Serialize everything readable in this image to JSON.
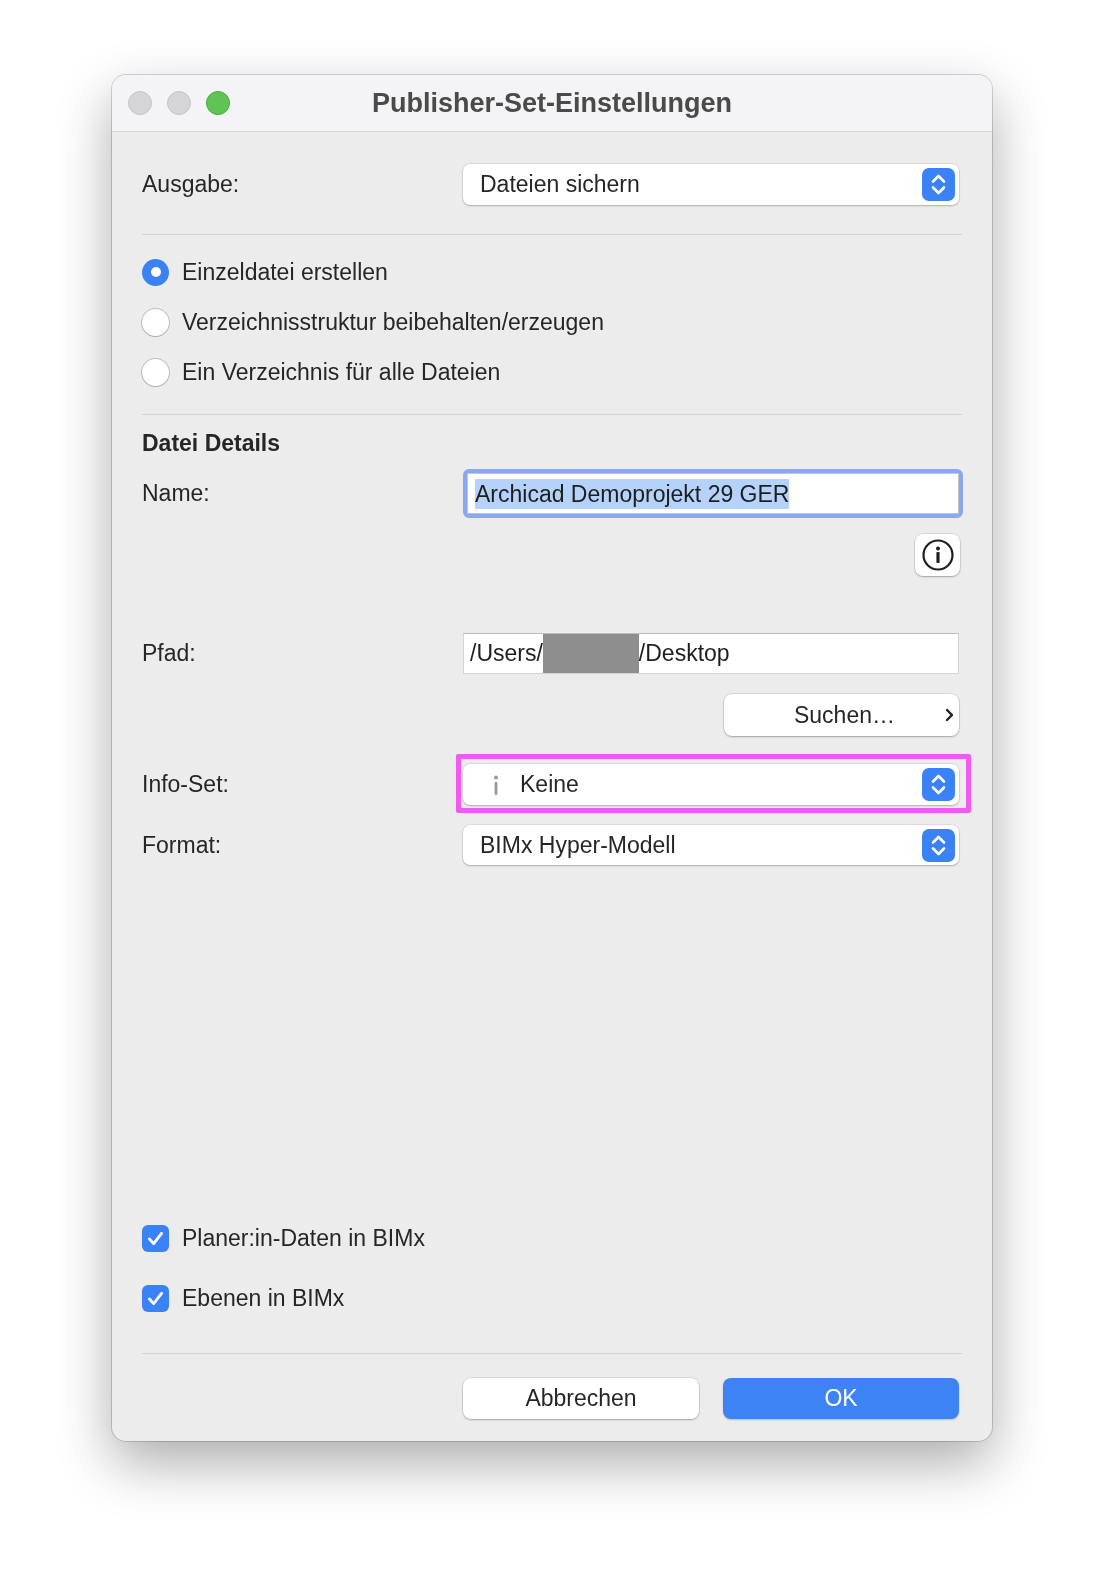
{
  "window": {
    "title": "Publisher-Set-Einstellungen",
    "controls": [
      {
        "kind": "close",
        "enabled": false
      },
      {
        "kind": "minimize",
        "enabled": false
      },
      {
        "kind": "zoom",
        "enabled": true
      }
    ]
  },
  "output": {
    "label": "Ausgabe:",
    "value": "Dateien sichern"
  },
  "structure_options": [
    {
      "label": "Einzeldatei erstellen",
      "selected": true
    },
    {
      "label": "Verzeichnisstruktur beibehalten/erzeugen",
      "selected": false
    },
    {
      "label": "Ein Verzeichnis für alle Dateien",
      "selected": false
    }
  ],
  "file_details": {
    "heading": "Datei Details",
    "name": {
      "label": "Name:",
      "value": "Archicad Demoprojekt 29 GER",
      "focused": true,
      "text_selected": true
    },
    "path": {
      "label": "Pfad:",
      "value_start": "/Users/",
      "value_end": "/Desktop",
      "redacted": true
    },
    "browse_button": "Suchen…",
    "info_set": {
      "label": "Info-Set:",
      "value": "Keine",
      "highlighted": true
    },
    "format": {
      "label": "Format:",
      "value": "BIMx Hyper-Modell"
    }
  },
  "bimx_options": [
    {
      "label": "Planer:in-Daten in BIMx",
      "checked": true
    },
    {
      "label": "Ebenen in BIMx",
      "checked": true
    }
  ],
  "buttons": [
    {
      "label": "Abbrechen",
      "kind": "cancel"
    },
    {
      "label": "OK",
      "kind": "default"
    }
  ]
}
